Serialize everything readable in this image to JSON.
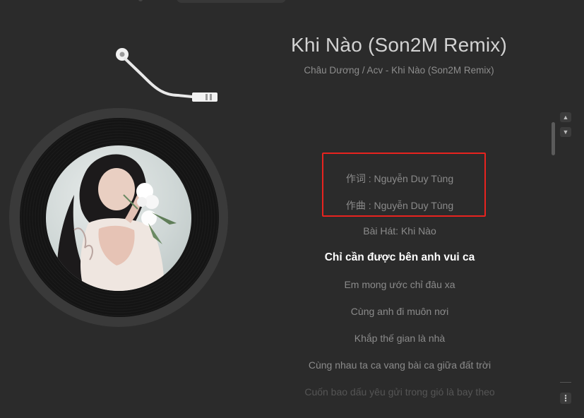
{
  "song": {
    "title": "Khi Nào (Son2M Remix)",
    "subtitle": "Châu Dương / Acv - Khi Nào (Son2M Remix)"
  },
  "lyrics": [
    {
      "text": "作词 : Nguyễn Duy Tùng",
      "state": "normal"
    },
    {
      "text": "作曲 : Nguyễn Duy Tùng",
      "state": "normal"
    },
    {
      "text": "Bài Hát: Khi Nào",
      "state": "normal"
    },
    {
      "text": "Chỉ cần được bên anh vui ca",
      "state": "active"
    },
    {
      "text": "Em mong ước chỉ đâu xa",
      "state": "normal"
    },
    {
      "text": "Cùng anh đi muôn nơi",
      "state": "normal"
    },
    {
      "text": "Khắp thế gian là nhà",
      "state": "normal"
    },
    {
      "text": "Cùng nhau ta ca vang bài ca giữa đất trời",
      "state": "normal"
    },
    {
      "text": "Cuốn bao dấu yêu gửi trong gió là bay theo",
      "state": "fade"
    }
  ],
  "controls": {
    "scroll_up_icon": "chevron-up-icon",
    "scroll_down_icon": "chevron-down-icon",
    "more_icon": "more-vertical-icon"
  },
  "colors": {
    "background": "#2b2b2b",
    "highlight_border": "#e8231f",
    "active_lyric": "#ffffff"
  }
}
